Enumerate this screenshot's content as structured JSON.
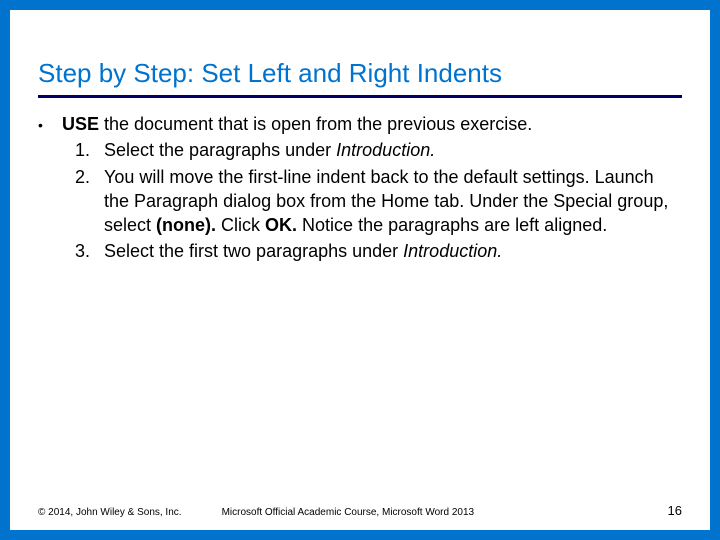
{
  "title": "Step by Step: Set Left and Right Indents",
  "bullet": {
    "mark": "•",
    "lead_bold": "USE",
    "lead_rest": " the document that is open from the previous exercise."
  },
  "steps": [
    {
      "num": "1.",
      "pre": "Select the paragraphs under ",
      "em": "Introduction.",
      "post": ""
    },
    {
      "num": "2.",
      "pre": "You will move the first-line indent back to the default settings. Launch the Paragraph dialog box from the Home tab. Under the Special group, select ",
      "bold1": "(none).",
      "mid": " Click ",
      "bold2": "OK.",
      "post": " Notice the paragraphs are left aligned."
    },
    {
      "num": "3.",
      "pre": "Select the first two paragraphs under ",
      "em": "Introduction.",
      "post": ""
    }
  ],
  "footer": {
    "copyright": "© 2014, John Wiley & Sons, Inc.",
    "course": "Microsoft Official Academic Course, Microsoft Word 2013",
    "page": "16"
  }
}
